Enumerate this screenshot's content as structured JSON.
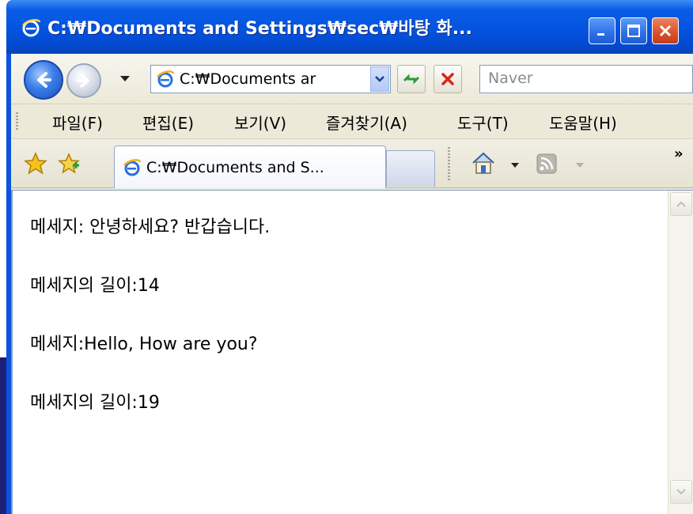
{
  "window": {
    "title": "C:₩Documents and Settings₩sec₩바탕 화..."
  },
  "nav": {
    "address_value": "C:₩Documents ar",
    "search_placeholder": "Naver"
  },
  "menu": {
    "items": [
      "파일(F)",
      "편집(E)",
      "보기(V)",
      "즐겨찾기(A)",
      "도구(T)",
      "도움말(H)"
    ]
  },
  "tabs": {
    "active_label": "C:₩Documents and S...",
    "overflow_label": "»"
  },
  "content": {
    "lines": [
      "메세지: 안녕하세요? 반갑습니다.",
      "메세지의 길이:14",
      "메세지:Hello, How are you?",
      "메세지의 길이:19"
    ]
  },
  "colors": {
    "titlebar": "#0453e0",
    "close_button": "#d9502a",
    "chrome": "#ece9d8",
    "slide_background": "#2b2a8a"
  },
  "icons": {
    "title": "ie-logo-icon",
    "back": "back-arrow-icon",
    "forward": "forward-arrow-icon",
    "refresh": "refresh-icon",
    "stop": "stop-icon",
    "favorites": "favorites-star-icon",
    "add_favorite": "add-favorite-icon",
    "home": "home-icon",
    "feeds": "feed-icon"
  }
}
